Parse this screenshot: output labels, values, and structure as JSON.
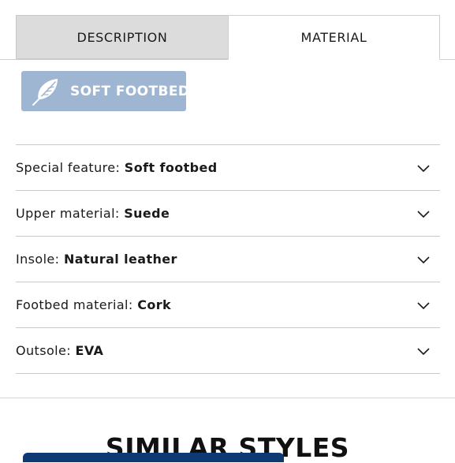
{
  "tabs": [
    {
      "label": "DESCRIPTION",
      "active": false
    },
    {
      "label": "MATERIAL",
      "active": true
    }
  ],
  "badge": {
    "label": "SOFT FOOTBED",
    "icon": "feather-icon",
    "color": "#9fb6d2"
  },
  "features": [
    {
      "label": "Special feature:",
      "value": "Soft footbed"
    },
    {
      "label": "Upper material:",
      "value": "Suede"
    },
    {
      "label": "Insole:",
      "value": "Natural leather"
    },
    {
      "label": "Footbed material:",
      "value": "Cork"
    },
    {
      "label": "Outsole:",
      "value": "EVA"
    }
  ],
  "similar": {
    "title": "SIMILAR STYLES"
  },
  "colors": {
    "accent": "#0e3a73",
    "tab_inactive_bg": "#dcdcdc"
  }
}
